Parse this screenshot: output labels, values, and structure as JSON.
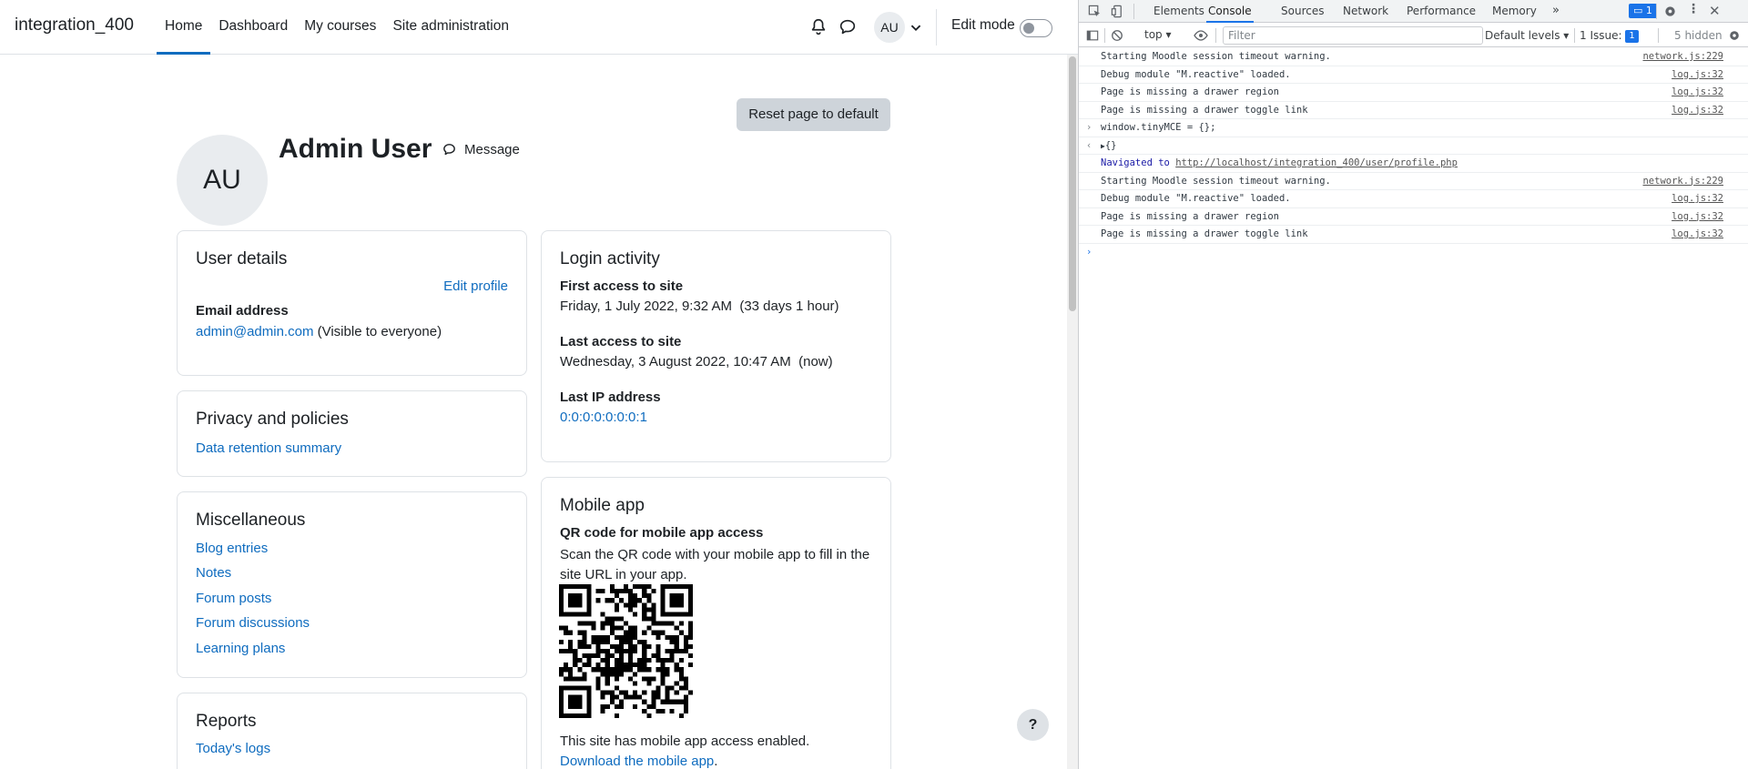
{
  "site": {
    "brand": "integration_400"
  },
  "nav": {
    "items": [
      "Home",
      "Dashboard",
      "My courses",
      "Site administration"
    ],
    "active": "Home"
  },
  "user_menu": {
    "initials": "AU"
  },
  "edit_mode": {
    "label": "Edit mode",
    "enabled": false
  },
  "page": {
    "reset_button": "Reset page to default",
    "avatar_initials": "AU",
    "title": "Admin User",
    "message_link": "Message",
    "help_button": "?"
  },
  "user_details": {
    "title": "User details",
    "edit_link": "Edit profile",
    "email_label": "Email address",
    "email": "admin@admin.com",
    "email_visibility": "(Visible to everyone)"
  },
  "privacy": {
    "title": "Privacy and policies",
    "link": "Data retention summary"
  },
  "misc": {
    "title": "Miscellaneous",
    "links": [
      "Blog entries",
      "Notes",
      "Forum posts",
      "Forum discussions",
      "Learning plans"
    ]
  },
  "reports": {
    "title": "Reports",
    "links": [
      "Today's logs"
    ]
  },
  "login_activity": {
    "title": "Login activity",
    "first_label": "First access to site",
    "first_value": "Friday, 1 July 2022, 9:32 AM  (33 days 1 hour)",
    "last_label": "Last access to site",
    "last_value": "Wednesday, 3 August 2022, 10:47 AM  (now)",
    "ip_label": "Last IP address",
    "ip_value": "0:0:0:0:0:0:0:1"
  },
  "mobile_app": {
    "title": "Mobile app",
    "qr_label": "QR code for mobile app access",
    "qr_text": "Scan the QR code with your mobile app to fill in the site URL in your app.",
    "enabled_text": "This site has mobile app access enabled.",
    "download_link": "Download the mobile app",
    "download_suffix": "."
  },
  "devtools": {
    "tabs": [
      "Elements",
      "Console",
      "Sources",
      "Network",
      "Performance",
      "Memory"
    ],
    "active_tab": "Console",
    "messages_badge": "1",
    "context": "top",
    "filter_placeholder": "Filter",
    "levels": "Default levels",
    "issues_label": "1 Issue:",
    "issues_count": "1",
    "hidden": "5 hidden",
    "console_lines": [
      {
        "text": "Starting Moodle session timeout warning.",
        "src": "network.js:229"
      },
      {
        "text": "Debug module \"M.reactive\" loaded.",
        "src": "log.js:32"
      },
      {
        "text": "Page is missing a drawer region",
        "src": "log.js:32"
      },
      {
        "text": "Page is missing a drawer toggle link",
        "src": "log.js:32"
      }
    ],
    "input_line": "window.tinyMCE = {};",
    "result_line": "{}",
    "navigated_prefix": "Navigated to",
    "navigated_url": "http://localhost/integration_400/user/profile.php",
    "console_lines_2": [
      {
        "text": "Starting Moodle session timeout warning.",
        "src": "network.js:229"
      },
      {
        "text": "Debug module \"M.reactive\" loaded.",
        "src": "log.js:32"
      },
      {
        "text": "Page is missing a drawer region",
        "src": "log.js:32"
      },
      {
        "text": "Page is missing a drawer toggle link",
        "src": "log.js:32"
      }
    ]
  }
}
